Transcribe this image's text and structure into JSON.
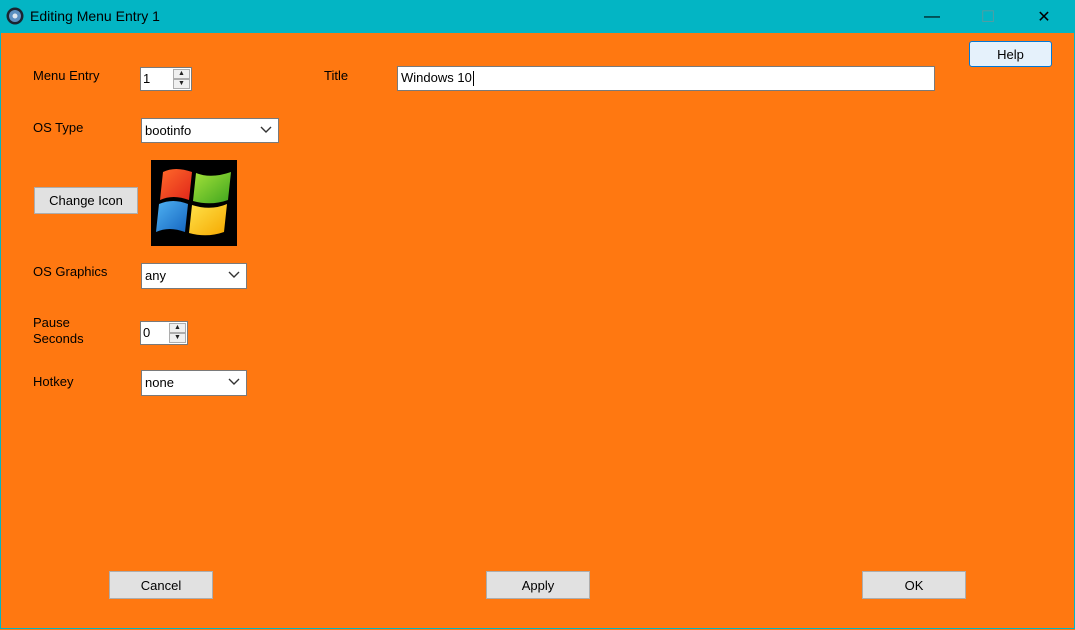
{
  "window": {
    "title": "Editing Menu Entry 1",
    "app_icon": "app-disc-icon",
    "controls": {
      "minimize": "—",
      "maximize": "☐",
      "close": "✕"
    }
  },
  "form": {
    "menu_entry": {
      "label": "Menu Entry",
      "value": "1"
    },
    "title": {
      "label": "Title",
      "value": "Windows 10"
    },
    "os_type": {
      "label": "OS Type",
      "value": "bootinfo"
    },
    "change_icon": {
      "label": "Change Icon",
      "icon": "windows-logo-icon"
    },
    "os_graphics": {
      "label": "OS Graphics",
      "value": "any"
    },
    "pause_seconds": {
      "label_line1": "Pause",
      "label_line2": "Seconds",
      "value": "0"
    },
    "hotkey": {
      "label": "Hotkey",
      "value": "none"
    }
  },
  "buttons": {
    "help": "Help",
    "cancel": "Cancel",
    "apply": "Apply",
    "ok": "OK"
  },
  "colors": {
    "titlebar": "#03b5c4",
    "background": "#ff7811"
  }
}
